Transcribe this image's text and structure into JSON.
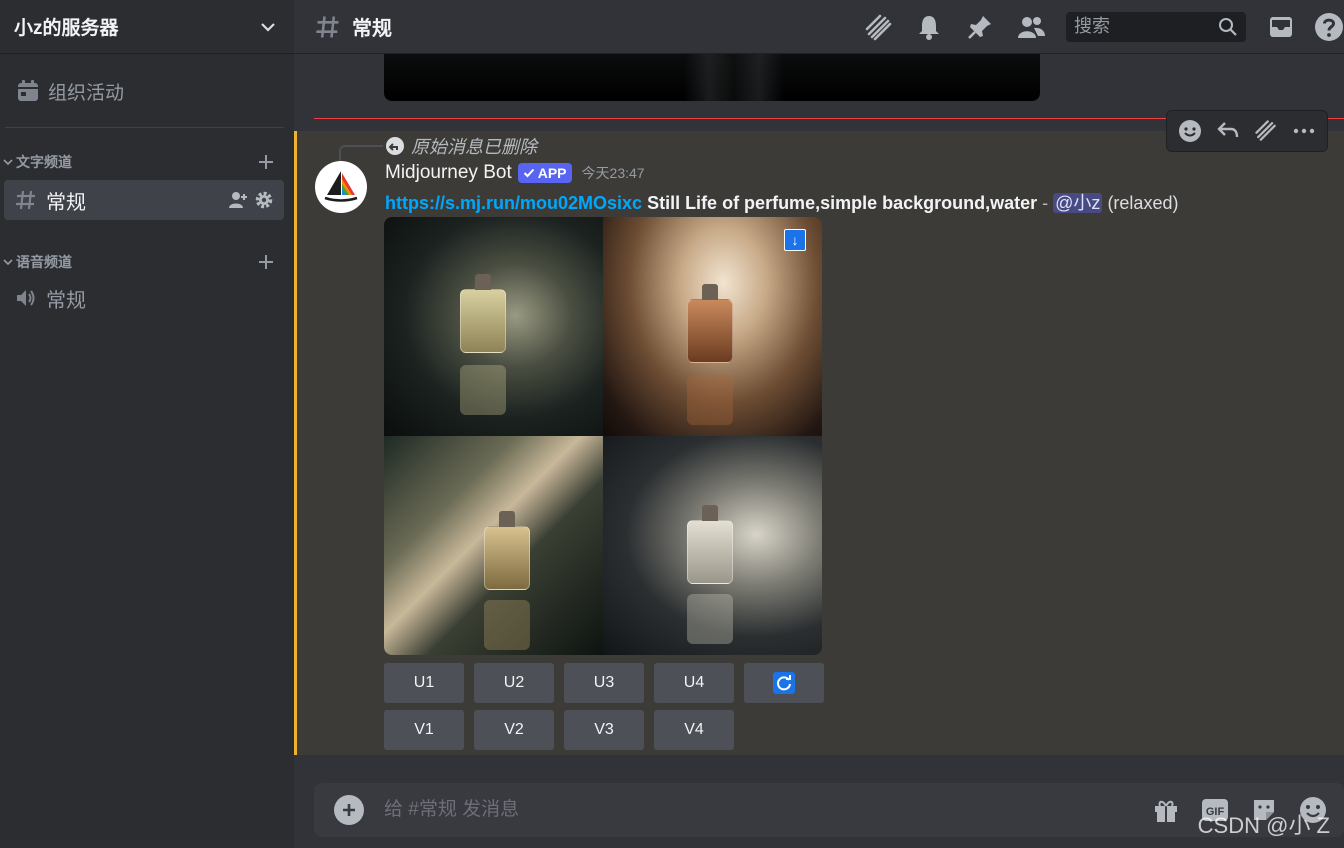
{
  "server": {
    "name": "小z的服务器"
  },
  "sidebar": {
    "events_label": "组织活动",
    "categories": [
      {
        "name": "文字频道",
        "channels": [
          {
            "name": "常规",
            "type": "text",
            "active": true
          }
        ]
      },
      {
        "name": "语音频道",
        "channels": [
          {
            "name": "常规",
            "type": "voice",
            "active": false
          }
        ]
      }
    ]
  },
  "header": {
    "channel_name": "常规",
    "search_placeholder": "搜索"
  },
  "message": {
    "reply_ref": "原始消息已删除",
    "author": "Midjourney Bot",
    "badge": "APP",
    "timestamp": "今天23:47",
    "link": "https://s.mj.run/mou02MOsixc",
    "prompt": "Still Life of perfume,simple background,water",
    "separator": " - ",
    "mention": "@小z",
    "mode": "(relaxed)",
    "upscale_buttons": [
      "U1",
      "U2",
      "U3",
      "U4"
    ],
    "variation_buttons": [
      "V1",
      "V2",
      "V3",
      "V4"
    ]
  },
  "composer": {
    "placeholder": "给 #常规 发消息"
  },
  "watermark": "CSDN @小 Z",
  "colors": {
    "accent": "#5865f2",
    "highlight": "#f0b232",
    "link": "#00a8fc",
    "new_divider": "#f23f42"
  }
}
